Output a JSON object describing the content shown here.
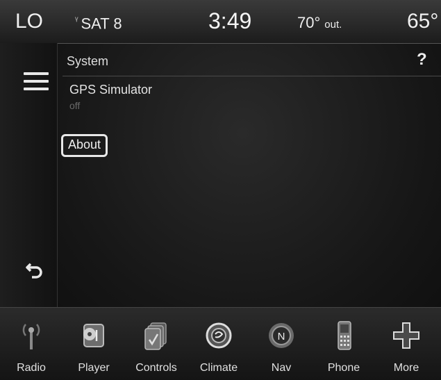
{
  "status_bar": {
    "left": "LO",
    "sat_station": "SAT 8",
    "time": "3:49",
    "outside_temp": "70°",
    "outside_label": "out.",
    "right_temp": "65°"
  },
  "panel": {
    "title": "System",
    "help": "?",
    "items": [
      {
        "label": "GPS Simulator",
        "value": "off"
      }
    ],
    "about_button": "About"
  },
  "left_rail": {
    "menu_icon": "hamburger-menu-icon",
    "back_icon": "back-arrow-icon"
  },
  "bottom_nav": {
    "tabs": [
      {
        "label": "Radio",
        "icon": "radio-antenna-icon"
      },
      {
        "label": "Player",
        "icon": "media-player-icon"
      },
      {
        "label": "Controls",
        "icon": "controls-icon"
      },
      {
        "label": "Climate",
        "icon": "climate-icon"
      },
      {
        "label": "Nav",
        "icon": "compass-icon"
      },
      {
        "label": "Phone",
        "icon": "phone-icon"
      },
      {
        "label": "More",
        "icon": "plus-icon"
      }
    ]
  }
}
